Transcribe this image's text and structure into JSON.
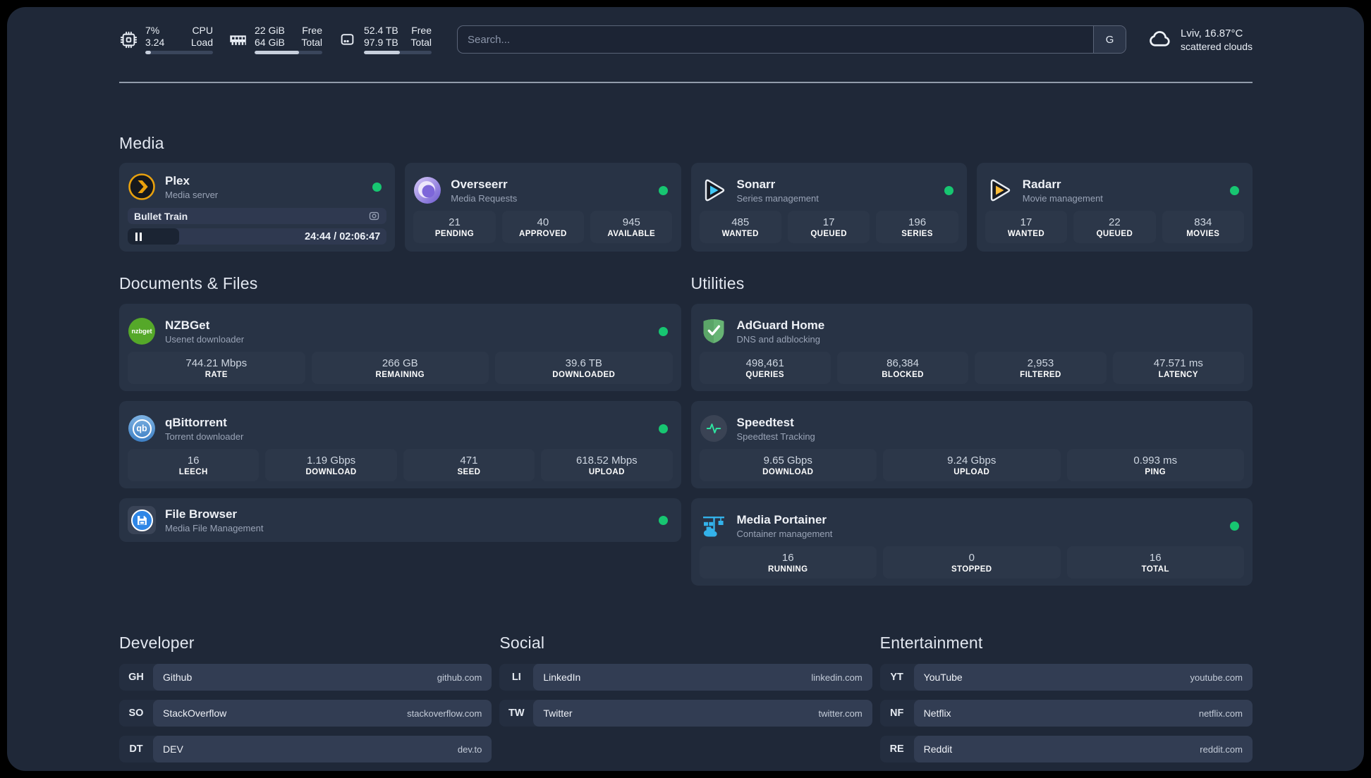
{
  "topbar": {
    "cpu": {
      "value_top": "7%",
      "value_bottom": "3.24",
      "label_top": "CPU",
      "label_bottom": "Load",
      "progress": "8%"
    },
    "ram": {
      "value_top": "22 GiB",
      "value_bottom": "64 GiB",
      "label_top": "Free",
      "label_bottom": "Total",
      "progress": "66%"
    },
    "disk": {
      "value_top": "52.4 TB",
      "value_bottom": "97.9 TB",
      "label_top": "Free",
      "label_bottom": "Total",
      "progress": "53%"
    },
    "search": {
      "placeholder": "Search...",
      "engine": "G"
    },
    "weather": {
      "line1": "Lviv, 16.87°C",
      "line2": "scattered clouds"
    }
  },
  "sections": {
    "media": "Media",
    "documents": "Documents & Files",
    "utilities": "Utilities",
    "developer": "Developer",
    "social": "Social",
    "entertainment": "Entertainment"
  },
  "apps": {
    "plex": {
      "name": "Plex",
      "desc": "Media server",
      "now_playing": "Bullet Train",
      "time": "24:44 / 02:06:47",
      "progress": "20%"
    },
    "overseerr": {
      "name": "Overseerr",
      "desc": "Media Requests",
      "stats": [
        {
          "value": "21",
          "label": "PENDING"
        },
        {
          "value": "40",
          "label": "APPROVED"
        },
        {
          "value": "945",
          "label": "AVAILABLE"
        }
      ]
    },
    "sonarr": {
      "name": "Sonarr",
      "desc": "Series management",
      "stats": [
        {
          "value": "485",
          "label": "WANTED"
        },
        {
          "value": "17",
          "label": "QUEUED"
        },
        {
          "value": "196",
          "label": "SERIES"
        }
      ]
    },
    "radarr": {
      "name": "Radarr",
      "desc": "Movie management",
      "stats": [
        {
          "value": "17",
          "label": "WANTED"
        },
        {
          "value": "22",
          "label": "QUEUED"
        },
        {
          "value": "834",
          "label": "MOVIES"
        }
      ]
    },
    "nzbget": {
      "name": "NZBGet",
      "desc": "Usenet downloader",
      "logo_text": "nzbget",
      "stats": [
        {
          "value": "744.21 Mbps",
          "label": "RATE"
        },
        {
          "value": "266 GB",
          "label": "REMAINING"
        },
        {
          "value": "39.6 TB",
          "label": "DOWNLOADED"
        }
      ]
    },
    "qbittorrent": {
      "name": "qBittorrent",
      "desc": "Torrent downloader",
      "logo_text": "qb",
      "stats": [
        {
          "value": "16",
          "label": "LEECH"
        },
        {
          "value": "1.19 Gbps",
          "label": "DOWNLOAD"
        },
        {
          "value": "471",
          "label": "SEED"
        },
        {
          "value": "618.52 Mbps",
          "label": "UPLOAD"
        }
      ]
    },
    "filebrowser": {
      "name": "File Browser",
      "desc": "Media File Management"
    },
    "adguard": {
      "name": "AdGuard Home",
      "desc": "DNS and adblocking",
      "stats": [
        {
          "value": "498,461",
          "label": "QUERIES"
        },
        {
          "value": "86,384",
          "label": "BLOCKED"
        },
        {
          "value": "2,953",
          "label": "FILTERED"
        },
        {
          "value": "47.571 ms",
          "label": "LATENCY"
        }
      ]
    },
    "speedtest": {
      "name": "Speedtest",
      "desc": "Speedtest Tracking",
      "stats": [
        {
          "value": "9.65 Gbps",
          "label": "DOWNLOAD"
        },
        {
          "value": "9.24 Gbps",
          "label": "UPLOAD"
        },
        {
          "value": "0.993 ms",
          "label": "PING"
        }
      ]
    },
    "portainer": {
      "name": "Media Portainer",
      "desc": "Container management",
      "stats": [
        {
          "value": "16",
          "label": "RUNNING"
        },
        {
          "value": "0",
          "label": "STOPPED"
        },
        {
          "value": "16",
          "label": "TOTAL"
        }
      ]
    }
  },
  "bookmarks": {
    "developer": [
      {
        "abbr": "GH",
        "name": "Github",
        "url": "github.com"
      },
      {
        "abbr": "SO",
        "name": "StackOverflow",
        "url": "stackoverflow.com"
      },
      {
        "abbr": "DT",
        "name": "DEV",
        "url": "dev.to"
      }
    ],
    "social": [
      {
        "abbr": "LI",
        "name": "LinkedIn",
        "url": "linkedin.com"
      },
      {
        "abbr": "TW",
        "name": "Twitter",
        "url": "twitter.com"
      }
    ],
    "entertainment": [
      {
        "abbr": "YT",
        "name": "YouTube",
        "url": "youtube.com"
      },
      {
        "abbr": "NF",
        "name": "Netflix",
        "url": "netflix.com"
      },
      {
        "abbr": "RE",
        "name": "Reddit",
        "url": "reddit.com"
      }
    ]
  },
  "icons": {
    "topbar": [
      "cpu-icon",
      "ram-icon",
      "disk-icon",
      "cloud-icon"
    ],
    "apps": [
      "plex-icon",
      "overseerr-icon",
      "sonarr-icon",
      "radarr-icon",
      "nzbget-icon",
      "qbittorrent-icon",
      "filebrowser-icon",
      "adguard-icon",
      "speedtest-icon",
      "portainer-icon"
    ],
    "misc": [
      "camera-icon",
      "pause-icon",
      "search-engine-g"
    ]
  },
  "colors": {
    "status_online": "#17c671",
    "plex": "#e8a10e",
    "sonarr": "#3fc6f3",
    "radarr": "#fdbd3a",
    "portainer": "#33b2ea"
  }
}
